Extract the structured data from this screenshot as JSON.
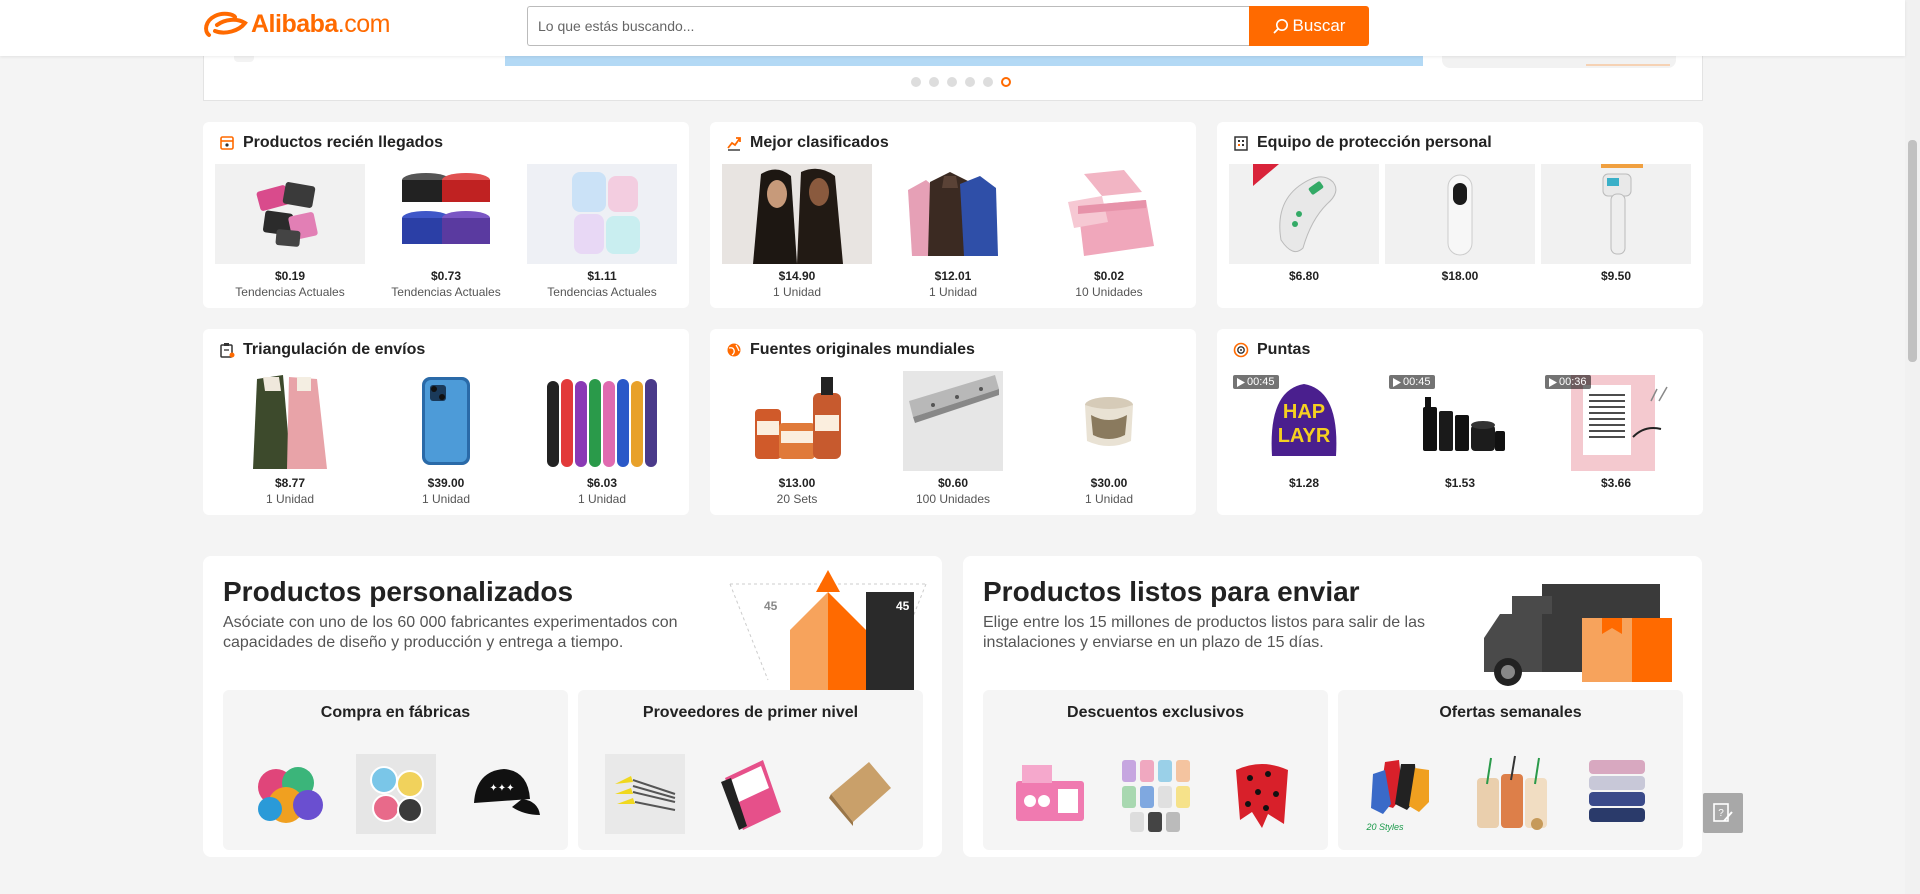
{
  "header": {
    "logo_text": "Alibaba",
    "logo_suffix": ".com",
    "search_placeholder": "Lo que estás buscando...",
    "search_button": "Buscar"
  },
  "colors": {
    "accent": "#ff6a00",
    "background": "#f4f4f4"
  },
  "carousel": {
    "dot_count": 6,
    "active_index": 5
  },
  "categories": [
    {
      "title": "Productos recién llegados",
      "icon": "new-arrivals-icon",
      "items": [
        {
          "price": "$0.19",
          "sub": "Tendencias Actuales",
          "image": "stickers"
        },
        {
          "price": "$0.73",
          "sub": "Tendencias Actuales",
          "image": "hair-wax-jars"
        },
        {
          "price": "$1.11",
          "sub": "Tendencias Actuales",
          "image": "water-bottles"
        }
      ]
    },
    {
      "title": "Mejor clasificados",
      "icon": "trending-up-icon",
      "items": [
        {
          "price": "$14.90",
          "sub": "1 Unidad",
          "image": "wigs"
        },
        {
          "price": "$12.01",
          "sub": "1 Unidad",
          "image": "hoodies"
        },
        {
          "price": "$0.02",
          "sub": "10 Unidades",
          "image": "pink-boxes"
        }
      ]
    },
    {
      "title": "Equipo de protección personal",
      "icon": "building-icon",
      "items": [
        {
          "price": "$6.80",
          "sub": "",
          "image": "thermometer"
        },
        {
          "price": "$18.00",
          "sub": "",
          "image": "thermometer-white"
        },
        {
          "price": "$9.50",
          "sub": "",
          "image": "thermometer-gun"
        }
      ]
    },
    {
      "title": "Triangulación de envíos",
      "icon": "clipboard-icon",
      "items": [
        {
          "price": "$8.77",
          "sub": "1 Unidad",
          "image": "coats"
        },
        {
          "price": "$39.00",
          "sub": "1 Unidad",
          "image": "smartphone"
        },
        {
          "price": "$6.03",
          "sub": "1 Unidad",
          "image": "bodysuits"
        }
      ]
    },
    {
      "title": "Fuentes originales mundiales",
      "icon": "globe-icon",
      "items": [
        {
          "price": "$13.00",
          "sub": "20 Sets",
          "image": "cosmetics"
        },
        {
          "price": "$0.60",
          "sub": "100 Unidades",
          "image": "aluminum-profile"
        },
        {
          "price": "$30.00",
          "sub": "1 Unidad",
          "image": "candle"
        }
      ]
    },
    {
      "title": "Puntas",
      "icon": "target-icon",
      "items": [
        {
          "price": "$1.28",
          "sub": "",
          "image": "beanie",
          "video": "00:45"
        },
        {
          "price": "$1.53",
          "sub": "",
          "image": "hair-care-set",
          "video": "00:45"
        },
        {
          "price": "$3.66",
          "sub": "",
          "image": "eyelashes",
          "video": "00:36"
        }
      ]
    }
  ],
  "promos": [
    {
      "title": "Productos personalizados",
      "desc": "Asóciate con uno de los 60 000 fabricantes experimentados con capacidades de diseño y producción y entrega a tiempo.",
      "art_labels": [
        "45",
        "45"
      ],
      "subcards": [
        {
          "title": "Compra en fábricas",
          "images": [
            "pin-badges",
            "button-pins",
            "black-cap"
          ]
        },
        {
          "title": "Proveedores de primer nivel",
          "images": [
            "makeup-brushes",
            "pink-bag",
            "cork-notebook"
          ]
        }
      ]
    },
    {
      "title": "Productos listos para enviar",
      "desc": "Elige entre los 15 millones de productos listos para salir de las instalaciones y enviarse en un plazo de 15 días.",
      "subcards": [
        {
          "title": "Descuentos exclusivos",
          "images": [
            "toy-kitchen",
            "tumblers",
            "scarf"
          ]
        },
        {
          "title": "Ofertas semanales",
          "images": [
            "socks",
            "glass-cups",
            "towels"
          ],
          "caption": "20 Styles"
        }
      ]
    }
  ]
}
